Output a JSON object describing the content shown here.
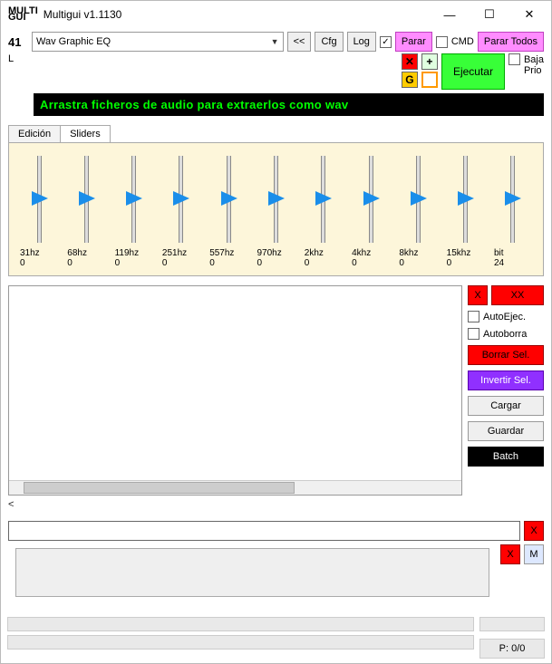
{
  "window": {
    "logo_top": "MULTI",
    "logo_bot": "GUI",
    "title": "Multigui v1.1130"
  },
  "toolbar": {
    "num": "41",
    "combo": "Wav Graphic EQ",
    "back": "<<",
    "cfg": "Cfg",
    "log": "Log",
    "parar": "Parar",
    "cmd": "CMD",
    "parar_todos": "Parar Todos",
    "l": "L",
    "ejecutar": "Ejecutar",
    "baja": "Baja",
    "prio": "Prio",
    "g": "G",
    "plus": "+"
  },
  "banner": "Arrastra ficheros de audio para extraerlos como wav",
  "tabs": {
    "edicion": "Edición",
    "sliders": "Sliders"
  },
  "sliders": [
    {
      "label": "31hz",
      "val": "0"
    },
    {
      "label": "68hz",
      "val": "0"
    },
    {
      "label": "119hz",
      "val": "0"
    },
    {
      "label": "251hz",
      "val": "0"
    },
    {
      "label": "557hz",
      "val": "0"
    },
    {
      "label": "970hz",
      "val": "0"
    },
    {
      "label": "2khz",
      "val": "0"
    },
    {
      "label": "4khz",
      "val": "0"
    },
    {
      "label": "8khz",
      "val": "0"
    },
    {
      "label": "15khz",
      "val": "0"
    },
    {
      "label": "bit",
      "val": "24"
    }
  ],
  "side": {
    "x": "X",
    "xx": "XX",
    "autoejec": "AutoEjec.",
    "autoborra": "Autoborra",
    "borrar": "Borrar Sel.",
    "invertir": "Invertir Sel.",
    "cargar": "Cargar",
    "guardar": "Guardar",
    "batch": "Batch"
  },
  "lt": "<",
  "logbtns": {
    "x": "X",
    "m": "M"
  },
  "pager": "P: 0/0"
}
